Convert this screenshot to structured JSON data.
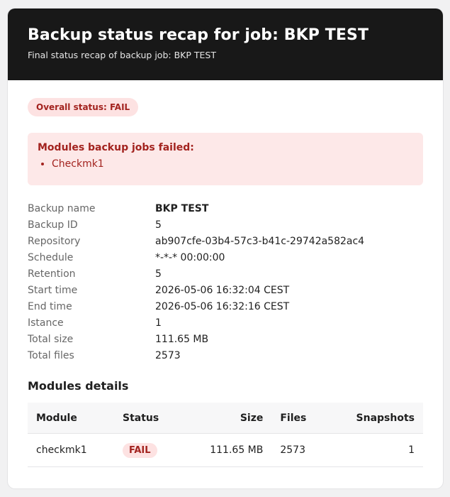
{
  "header": {
    "title": "Backup status recap for job: BKP TEST",
    "subtitle": "Final status recap of backup job: BKP TEST"
  },
  "overall": {
    "label": "Overall status: FAIL"
  },
  "alert": {
    "title": "Modules backup jobs failed:",
    "items": [
      "Checkmk1"
    ]
  },
  "details": [
    {
      "key": "Backup name",
      "value": "BKP TEST"
    },
    {
      "key": "Backup ID",
      "value": "5"
    },
    {
      "key": "Repository",
      "value": "ab907cfe-03b4-57c3-b41c-29742a582ac4"
    },
    {
      "key": "Schedule",
      "value": "*-*-* 00:00:00"
    },
    {
      "key": "Retention",
      "value": "5"
    },
    {
      "key": "Start time",
      "value": "2026-05-06 16:32:04 CEST"
    },
    {
      "key": "End time",
      "value": "2026-05-06 16:32:16 CEST"
    },
    {
      "key": "Istance",
      "value": "1"
    },
    {
      "key": "Total size",
      "value": "111.65 MB"
    },
    {
      "key": "Total files",
      "value": "2573"
    }
  ],
  "modules": {
    "title": "Modules details",
    "columns": [
      "Module",
      "Status",
      "Size",
      "Files",
      "Snapshots"
    ],
    "rows": [
      {
        "module": "checkmk1",
        "status": "FAIL",
        "size": "111.65 MB",
        "files": "2573",
        "snapshots": "1"
      }
    ]
  },
  "colors": {
    "header_bg": "#181818",
    "fail_text": "#a3231f",
    "fail_bg": "#fde2e2"
  }
}
